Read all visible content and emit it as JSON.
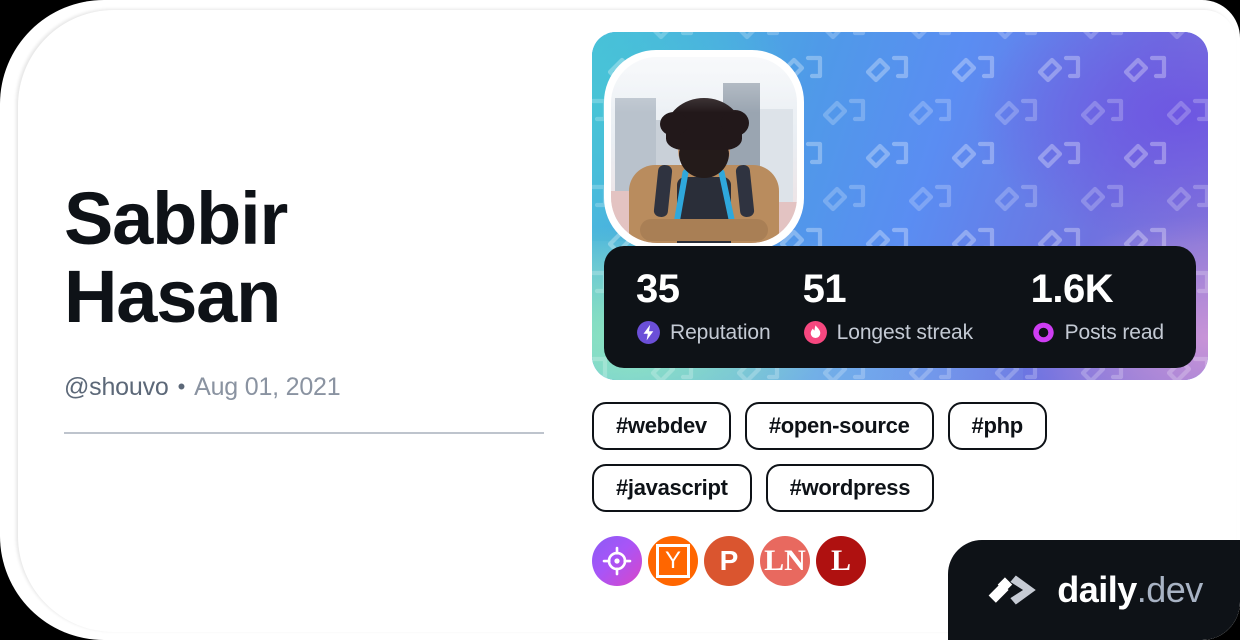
{
  "card": {
    "background": "#ffffff",
    "page_background": "#000000"
  },
  "profile": {
    "display_name": "Sabbir Hasan",
    "handle": "@shouvo",
    "separator": "•",
    "joined_date": "Aug 01, 2021",
    "avatar_alt": "Illustrated portrait of a bearded man with curly hair wearing a tan jacket in front of city buildings"
  },
  "stats": [
    {
      "value": "35",
      "label": "Reputation",
      "icon": "reputation-bolt-icon",
      "color": "#6B4FD8"
    },
    {
      "value": "51",
      "label": "Longest streak",
      "icon": "streak-flame-icon",
      "color": "#F6477F"
    },
    {
      "value": "1.6K",
      "label": "Posts read",
      "icon": "posts-read-ring-icon",
      "color": "#CE3DF3"
    }
  ],
  "tags": [
    {
      "label": "#webdev"
    },
    {
      "label": "#open-source"
    },
    {
      "label": "#php"
    },
    {
      "label": "#javascript"
    },
    {
      "label": "#wordpress"
    }
  ],
  "badges": [
    {
      "name": "target-source-badge",
      "letter": "",
      "color": "#A855F7"
    },
    {
      "name": "hacker-news-source-badge",
      "letter": "Y",
      "color": "#FF6600"
    },
    {
      "name": "product-hunt-source-badge",
      "letter": "P",
      "color": "#DA552F"
    },
    {
      "name": "ln-source-badge",
      "letter": "LN",
      "color": "#E8695F"
    },
    {
      "name": "l-source-badge",
      "letter": "L",
      "color": "#AF1110"
    }
  ],
  "brand": {
    "name": "daily",
    "suffix": ".dev",
    "mark": "daily-dev-chevron-logo",
    "background": "#0E1217"
  }
}
